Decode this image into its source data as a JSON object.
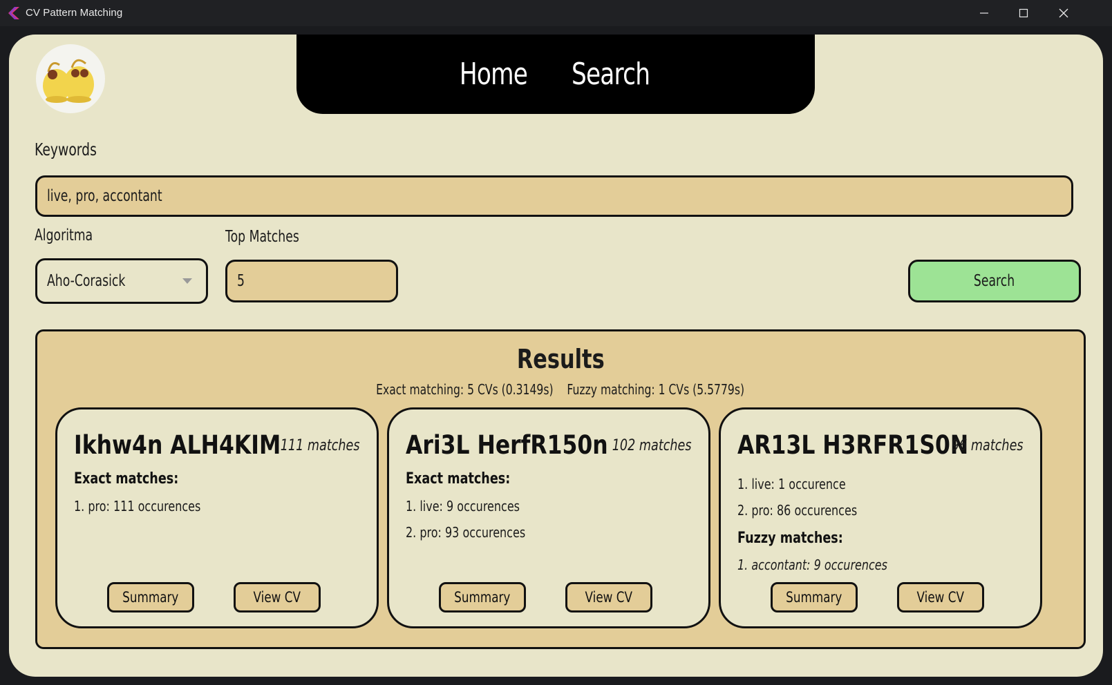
{
  "window": {
    "title": "CV Pattern Matching",
    "controls": [
      "minimize",
      "maximize",
      "close"
    ]
  },
  "nav": {
    "links": [
      {
        "label": "Home"
      },
      {
        "label": "Search"
      }
    ]
  },
  "form": {
    "keywords_label": "Keywords",
    "keywords_value": "live, pro, accontant",
    "algorithm_label": "Algoritma",
    "algorithm_value": "Aho-Corasick",
    "top_label": "Top Matches",
    "top_value": "5",
    "search_label": "Search"
  },
  "results": {
    "title": "Results",
    "summary": "Exact matching: 5 CVs (0.3149s)    Fuzzy matching: 1 CVs (5.5779s)",
    "cards": [
      {
        "name": "Ikhw4n ALH4KIM",
        "count": "111 matches",
        "exact_heading": "Exact matches:",
        "exact": [
          "1. pro: 111 occurences"
        ],
        "fuzzy_heading": "",
        "fuzzy": [],
        "summary_label": "Summary",
        "view_label": "View CV"
      },
      {
        "name": "Ari3L HerfR150n",
        "count": "102 matches",
        "exact_heading": "Exact matches:",
        "exact": [
          "1. live: 9 occurences",
          "2. pro: 93 occurences"
        ],
        "fuzzy_heading": "",
        "fuzzy": [],
        "summary_label": "Summary",
        "view_label": "View CV"
      },
      {
        "name": "AR13L H3RFR1S0N",
        "count": "96 matches",
        "exact_heading": "",
        "exact": [
          "1. live: 1 occurence",
          "2. pro: 86 occurences"
        ],
        "fuzzy_heading": "Fuzzy matches:",
        "fuzzy": [
          "1. accontant: 9 occurences"
        ],
        "summary_label": "Summary",
        "view_label": "View CV"
      }
    ]
  },
  "colors": {
    "background": "#e8e5c9",
    "panel": "#e3cd98",
    "search_button": "#9de395",
    "nav": "#000000"
  }
}
